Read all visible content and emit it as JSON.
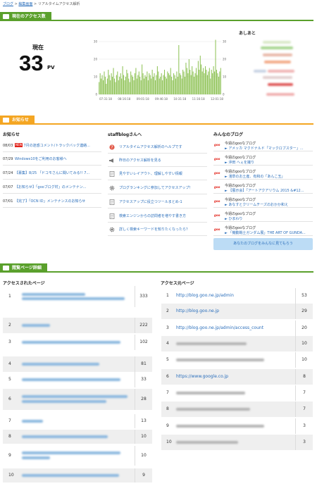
{
  "breadcrumb": {
    "item1": "ブログ",
    "sep": ">",
    "item2": "編集画面",
    "current": "リアルタイムアクセス解析"
  },
  "sections": {
    "access": "現在のアクセス数",
    "notice": "お知らせ",
    "detail": "閲覧ページ詳細"
  },
  "realtime": {
    "label": "現在",
    "value": "33",
    "unit": "PV"
  },
  "chart_data": {
    "type": "bar",
    "y_ticks": [
      "30",
      "20",
      "10",
      "0"
    ],
    "ylim": [
      0,
      36
    ],
    "x_ticks": [
      "07:31:18",
      "08:16:18",
      "09:01:18",
      "09:46:18",
      "10:31:18",
      "11:16:18",
      "12:01:18"
    ],
    "values": [
      7,
      12,
      9,
      11,
      8,
      13,
      10,
      6,
      9,
      14,
      11,
      8,
      12,
      10,
      15,
      9,
      7,
      11,
      13,
      8,
      10,
      12,
      9,
      16,
      11,
      8,
      10,
      14,
      12,
      9,
      7,
      13,
      11,
      10,
      8,
      12,
      15,
      9,
      11,
      13,
      10,
      8,
      17,
      12,
      9,
      11,
      10,
      13,
      8,
      12,
      11,
      9,
      14,
      10,
      12,
      8,
      11,
      16,
      13,
      9,
      10,
      12,
      8,
      11,
      14,
      10,
      9,
      13,
      12,
      11,
      15,
      10,
      8,
      12,
      11,
      9,
      13,
      10,
      28,
      12,
      11,
      9,
      14,
      13,
      10,
      18,
      15,
      12,
      20,
      14,
      11,
      16,
      13,
      10,
      12,
      15,
      11,
      19,
      14,
      22,
      17,
      13,
      15,
      12,
      16,
      14,
      11,
      13,
      15,
      9,
      14,
      12,
      16,
      13,
      31,
      14,
      12,
      10,
      13,
      15
    ]
  },
  "ashiato": {
    "title": "あしあと"
  },
  "notice": {
    "col1": "お知らせ",
    "col2": "staffblogさんへ",
    "col3": "みんなのブログ",
    "new_badge": "NEW",
    "news": [
      {
        "date": "08/03",
        "new": true,
        "text": "7月の迷惑コメント/トラックバック連絡..."
      },
      {
        "date": "07/29",
        "new": false,
        "text": "Windows10をご利用のお客様へ"
      },
      {
        "date": "07/24",
        "new": false,
        "text": "【募集】8/25 「ドコモさんに聞いてみる!! 7..."
      },
      {
        "date": "07/07",
        "new": false,
        "text": "【お知らせ】「gooブログ村」のメンテナン..."
      },
      {
        "date": "07/01",
        "new": false,
        "text": "【完了】「OCN ID」メンテナンスのお知らせ"
      }
    ],
    "staff": [
      "リアルタイムアクセス解析のヘルプです",
      "昨日のアクセス解析を見る",
      "見やすいレイアウト、理解しやすい情報",
      "プログランキングに参加してアクセスアップ！",
      "アクセスアップに役立つツールまとめ-1",
      "検索エンジンからの訪問者を増やす書き方",
      "詳しく検索キーワードを知りたくなったら？"
    ],
    "blog_logo": "goo",
    "blogs": [
      {
        "title": "今週のgooなブログ",
        "sub": "► アメッカ マクドナルド「マックロブスター」..."
      },
      {
        "title": "今週のgooなブログ",
        "sub": "► 沖田 へぇを撮り"
      },
      {
        "title": "今週のgooなブログ",
        "sub": "► 淺草のお土産、有和の「あんこ玉」"
      },
      {
        "title": "今週のgooなブログ",
        "sub": "► 【展示会】「アートアクアリウム 2015 &#12..."
      },
      {
        "title": "今週のgooなブログ",
        "sub": "► あなすとクリームチーズのおかか和え"
      },
      {
        "title": "今週のgooなブログ",
        "sub": "► ひまわり"
      },
      {
        "title": "今週のgooなブログ",
        "sub": "► 「機動戦士ガンダム展」THE ART OF GUNDA..."
      }
    ],
    "blog_button": "あなたのブログをみんなに見てもらう"
  },
  "detail": {
    "left_head": "アクセスされたページ",
    "right_head": "アクセス元ページ",
    "pages": [
      {
        "n": "1",
        "c": "333"
      },
      {
        "n": "2",
        "c": "222"
      },
      {
        "n": "3",
        "c": "102"
      },
      {
        "n": "4",
        "c": "81"
      },
      {
        "n": "5",
        "c": "33"
      },
      {
        "n": "6",
        "c": "28"
      },
      {
        "n": "7",
        "c": "13"
      },
      {
        "n": "8",
        "c": "10"
      },
      {
        "n": "9",
        "c": "10"
      },
      {
        "n": "10",
        "c": "9"
      }
    ],
    "refs": [
      {
        "n": "1",
        "u": "http://blog.goo.ne.jp/admin",
        "c": "53"
      },
      {
        "n": "2",
        "u": "http://blog.goo.ne.jp",
        "c": "29"
      },
      {
        "n": "3",
        "u": "http://blog.goo.ne.jp/admin/access_count",
        "c": "20"
      },
      {
        "n": "4",
        "u": "",
        "c": "10"
      },
      {
        "n": "5",
        "u": "",
        "c": "10"
      },
      {
        "n": "6",
        "u": "https://www.google.co.jp",
        "c": "8"
      },
      {
        "n": "7",
        "u": "",
        "c": "7"
      },
      {
        "n": "8",
        "u": "",
        "c": "7"
      },
      {
        "n": "9",
        "u": "",
        "c": "3"
      },
      {
        "n": "10",
        "u": "",
        "c": "3"
      }
    ]
  }
}
